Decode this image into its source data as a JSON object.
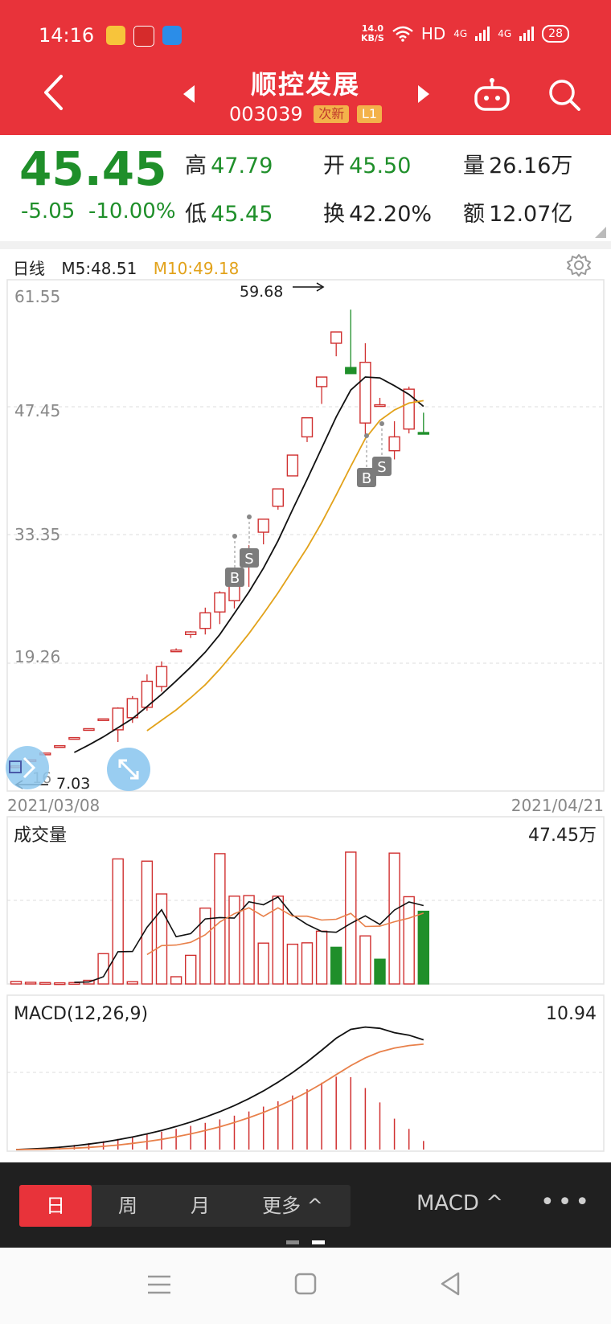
{
  "status_bar": {
    "time": "14:16",
    "net_speed": "14.0",
    "net_unit": "KB/S",
    "hd": "HD",
    "sig1": "4G",
    "sig2": "4G",
    "battery": "28"
  },
  "header": {
    "title": "顺控发展",
    "code": "003039",
    "tag_new": "次新",
    "tag_level": "L1"
  },
  "quote": {
    "price": "45.45",
    "change": "-5.05",
    "change_pct": "-10.00%",
    "high_label": "高",
    "high": "47.79",
    "low_label": "低",
    "low": "45.45",
    "open_label": "开",
    "open": "45.50",
    "turnover_label": "换",
    "turnover": "42.20%",
    "volume_label": "量",
    "volume": "26.16万",
    "amount_label": "额",
    "amount": "12.07亿",
    "colors": {
      "down": "#1f8f2a",
      "up": "#d03030",
      "ma5": "#111111",
      "ma10": "#e2a21a"
    }
  },
  "kline": {
    "period_label": "日线",
    "ma5_label": "M5:48.51",
    "ma10_label": "M10:49.18",
    "y_ticks": [
      "61.55",
      "47.45",
      "33.35",
      "19.26"
    ],
    "max_label": "59.68",
    "min_label": "7.03",
    "bottom_left_partial": "16",
    "date_start": "2021/03/08",
    "date_end": "2021/04/21",
    "marker_b": "B",
    "marker_s": "S"
  },
  "volume_panel": {
    "label": "成交量",
    "max_value": "47.45万"
  },
  "macd_panel": {
    "label": "MACD(12,26,9)",
    "value": "10.94"
  },
  "bottom_bar": {
    "tabs": [
      "日",
      "周",
      "月",
      "更多 ^"
    ],
    "indicator": "MACD ^",
    "more": "•••"
  },
  "chart_data": [
    {
      "type": "candlestick",
      "title": "日线",
      "x_range": [
        "2021/03/08",
        "2021/04/21"
      ],
      "ylim": [
        5.16,
        61.55
      ],
      "candles": [
        {
          "o": 7.03,
          "h": 7.03,
          "c": 7.03,
          "l": 7.03
        },
        {
          "o": 7.74,
          "h": 7.74,
          "c": 7.74,
          "l": 7.74
        },
        {
          "o": 8.51,
          "h": 8.51,
          "c": 8.51,
          "l": 8.51
        },
        {
          "o": 9.36,
          "h": 9.36,
          "c": 9.36,
          "l": 9.36
        },
        {
          "o": 10.3,
          "h": 10.3,
          "c": 10.3,
          "l": 10.3
        },
        {
          "o": 11.33,
          "h": 11.33,
          "c": 11.33,
          "l": 11.33
        },
        {
          "o": 12.46,
          "h": 12.46,
          "c": 12.46,
          "l": 12.46
        },
        {
          "o": 11.2,
          "h": 13.8,
          "c": 13.7,
          "l": 9.8
        },
        {
          "o": 12.6,
          "h": 15.1,
          "c": 14.8,
          "l": 12.0
        },
        {
          "o": 13.8,
          "h": 17.6,
          "c": 16.8,
          "l": 13.4
        },
        {
          "o": 16.2,
          "h": 19.1,
          "c": 18.5,
          "l": 15.6
        },
        {
          "o": 20.4,
          "h": 20.6,
          "c": 20.4,
          "l": 20.2
        },
        {
          "o": 22.2,
          "h": 22.6,
          "c": 22.5,
          "l": 21.8
        },
        {
          "o": 22.9,
          "h": 25.3,
          "c": 24.7,
          "l": 22.2
        },
        {
          "o": 24.8,
          "h": 27.2,
          "c": 27.0,
          "l": 23.4
        },
        {
          "o": 26.1,
          "h": 29.7,
          "c": 29.7,
          "l": 25.2
        },
        {
          "o": 30.3,
          "h": 32.5,
          "c": 31.6,
          "l": 27.7
        },
        {
          "o": 34.0,
          "h": 34.0,
          "c": 35.5,
          "l": 32.6
        },
        {
          "o": 37.0,
          "h": 39.0,
          "c": 39.0,
          "l": 36.6
        },
        {
          "o": 40.5,
          "h": 42.9,
          "c": 42.9,
          "l": 40.5
        },
        {
          "o": 45.0,
          "h": 47.2,
          "c": 47.2,
          "l": 44.4
        },
        {
          "o": 50.8,
          "h": 51.9,
          "c": 51.9,
          "l": 48.8
        },
        {
          "o": 55.8,
          "h": 57.1,
          "c": 57.1,
          "l": 54.3
        },
        {
          "o": 53.0,
          "h": 59.68,
          "c": 52.3,
          "l": 52.3
        },
        {
          "o": 46.6,
          "h": 55.8,
          "c": 53.6,
          "l": 45.3
        },
        {
          "o": 48.7,
          "h": 49.5,
          "c": 48.7,
          "l": 48.6
        },
        {
          "o": 43.4,
          "h": 46.8,
          "c": 45.0,
          "l": 42.4
        },
        {
          "o": 45.9,
          "h": 50.8,
          "c": 50.5,
          "l": 45.4
        },
        {
          "o": 45.5,
          "h": 47.79,
          "c": 45.45,
          "l": 45.45
        }
      ],
      "ma5": [
        null,
        null,
        null,
        null,
        8.59,
        9.45,
        10.39,
        11.45,
        12.5,
        13.89,
        15.3,
        16.84,
        18.44,
        20.16,
        22.2,
        24.64,
        27.1,
        29.86,
        33.0,
        36.6,
        40.1,
        43.7,
        47.3,
        50.4,
        51.9,
        51.8,
        50.9,
        49.9,
        48.51
      ],
      "ma10": [
        null,
        null,
        null,
        null,
        null,
        null,
        null,
        null,
        null,
        11.1,
        12.3,
        13.5,
        14.9,
        16.4,
        18.2,
        20.2,
        22.3,
        24.6,
        27.0,
        29.6,
        32.2,
        35.1,
        38.3,
        41.6,
        44.8,
        46.9,
        48.1,
        48.9,
        49.18
      ]
    },
    {
      "type": "bar",
      "title": "成交量",
      "ylim": [
        0,
        47.45
      ],
      "values": [
        0.9,
        0.6,
        0.5,
        0.4,
        0.5,
        1.3,
        10.9,
        45.0,
        0.8,
        44.2,
        32.4,
        2.6,
        10.3,
        27.3,
        46.9,
        31.6,
        31.8,
        14.7,
        31.6,
        14.3,
        14.8,
        19.0,
        13.2,
        47.45,
        17.3,
        8.9,
        47.1,
        31.4,
        26.16
      ],
      "directions": [
        "u",
        "u",
        "u",
        "u",
        "u",
        "u",
        "u",
        "u",
        "u",
        "u",
        "u",
        "u",
        "u",
        "u",
        "u",
        "u",
        "u",
        "u",
        "u",
        "u",
        "u",
        "u",
        "d",
        "u",
        "u",
        "d",
        "u",
        "u",
        "d"
      ],
      "ma5": [
        null,
        null,
        null,
        null,
        0.6,
        0.7,
        2.6,
        11.6,
        11.7,
        20.4,
        26.7,
        17.0,
        18.1,
        23.4,
        23.9,
        23.7,
        29.6,
        28.5,
        31.3,
        24.8,
        21.4,
        18.9,
        18.6,
        21.8,
        24.5,
        21.4,
        26.6,
        29.5,
        28.2
      ],
      "ma10": [
        null,
        null,
        null,
        null,
        null,
        null,
        null,
        null,
        null,
        10.6,
        13.8,
        14.0,
        15.0,
        17.7,
        22.3,
        25.3,
        27.4,
        24.3,
        27.4,
        24.4,
        24.4,
        23.0,
        23.3,
        25.4,
        20.7,
        20.8,
        22.4,
        23.7,
        25.5
      ]
    },
    {
      "type": "line",
      "title": "MACD(12,26,9)",
      "ylim": [
        0,
        10.94
      ],
      "dif": [
        0.0,
        0.05,
        0.11,
        0.2,
        0.32,
        0.47,
        0.64,
        0.85,
        1.08,
        1.35,
        1.65,
        1.99,
        2.37,
        2.79,
        3.26,
        3.79,
        4.38,
        5.05,
        5.8,
        6.63,
        7.55,
        8.55,
        9.59,
        10.35,
        10.55,
        10.44,
        10.07,
        9.85,
        9.45
      ],
      "dea": [
        0.0,
        0.01,
        0.03,
        0.07,
        0.12,
        0.19,
        0.28,
        0.39,
        0.53,
        0.69,
        0.88,
        1.1,
        1.35,
        1.64,
        1.96,
        2.33,
        2.74,
        3.2,
        3.72,
        4.3,
        4.95,
        5.67,
        6.45,
        7.23,
        7.9,
        8.41,
        8.74,
        8.96,
        9.08
      ],
      "hist": [
        0.0,
        0.08,
        0.16,
        0.26,
        0.4,
        0.56,
        0.72,
        0.92,
        1.1,
        1.32,
        1.54,
        1.78,
        2.04,
        2.3,
        2.6,
        2.92,
        3.28,
        3.7,
        4.16,
        4.66,
        5.2,
        5.76,
        6.28,
        6.24,
        5.3,
        4.06,
        2.66,
        1.78,
        0.74
      ]
    }
  ]
}
